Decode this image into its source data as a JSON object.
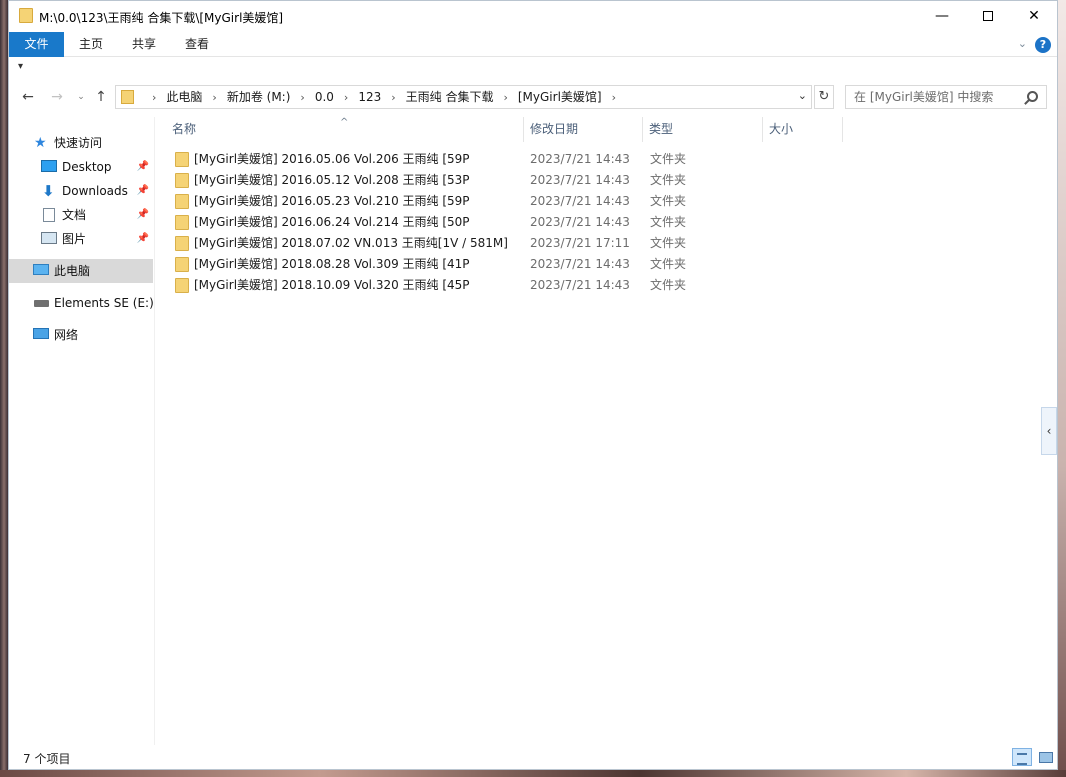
{
  "window": {
    "title": "M:\\0.0\\123\\王雨纯 合集下载\\[MyGirl美媛馆]",
    "min_glyph": "—",
    "close_glyph": "✕"
  },
  "ribbon": {
    "tabs": [
      "文件",
      "主页",
      "共享",
      "查看"
    ],
    "expand_glyph": "⌄",
    "help_glyph": "?"
  },
  "quick_access_glyph": "▾",
  "navigation": {
    "back_glyph": "←",
    "forward_glyph": "→",
    "recent_glyph": "⌄",
    "up_glyph": "↑",
    "refresh_glyph": "↻",
    "dropdown_glyph": "⌄",
    "separator": "›",
    "breadcrumbs": [
      "此电脑",
      "新加卷 (M:)",
      "0.0",
      "123",
      "王雨纯 合集下载",
      "[MyGirl美媛馆]"
    ]
  },
  "search": {
    "placeholder": "在 [MyGirl美媛馆] 中搜索"
  },
  "nav_pane": {
    "quick_access": "快速访问",
    "items": [
      {
        "label": "Desktop",
        "icon": "desktop-icon",
        "pinned": true
      },
      {
        "label": "Downloads",
        "icon": "download-icon",
        "pinned": true
      },
      {
        "label": "文档",
        "icon": "document-icon",
        "pinned": true
      },
      {
        "label": "图片",
        "icon": "pictures-icon",
        "pinned": true
      }
    ],
    "pin_glyph": "📌",
    "this_pc": "此电脑",
    "drive": "Elements SE (E:)",
    "network": "网络"
  },
  "columns": {
    "name": "名称",
    "date": "修改日期",
    "type": "类型",
    "size": "大小",
    "sort_glyph": "^"
  },
  "files": [
    {
      "name": "[MyGirl美媛馆] 2016.05.06 Vol.206 王雨纯 [59P",
      "date": "2023/7/21 14:43",
      "type": "文件夹"
    },
    {
      "name": "[MyGirl美媛馆] 2016.05.12 Vol.208 王雨纯 [53P",
      "date": "2023/7/21 14:43",
      "type": "文件夹"
    },
    {
      "name": "[MyGirl美媛馆] 2016.05.23 Vol.210 王雨纯 [59P",
      "date": "2023/7/21 14:43",
      "type": "文件夹"
    },
    {
      "name": "[MyGirl美媛馆] 2016.06.24 Vol.214 王雨纯 [50P",
      "date": "2023/7/21 14:43",
      "type": "文件夹"
    },
    {
      "name": "[MyGirl美媛馆] 2018.07.02 VN.013 王雨纯[1V / 581M]",
      "date": "2023/7/21 17:11",
      "type": "文件夹"
    },
    {
      "name": "[MyGirl美媛馆] 2018.08.28 Vol.309 王雨纯 [41P",
      "date": "2023/7/21 14:43",
      "type": "文件夹"
    },
    {
      "name": "[MyGirl美媛馆] 2018.10.09 Vol.320 王雨纯 [45P",
      "date": "2023/7/21 14:43",
      "type": "文件夹"
    }
  ],
  "preview_toggle_glyph": "‹",
  "status": {
    "item_count": "7 个项目"
  },
  "colors": {
    "accent": "#1979ca",
    "folder": "#f5d375",
    "selection": "#d9d9d9",
    "header_text": "#4c607a"
  }
}
